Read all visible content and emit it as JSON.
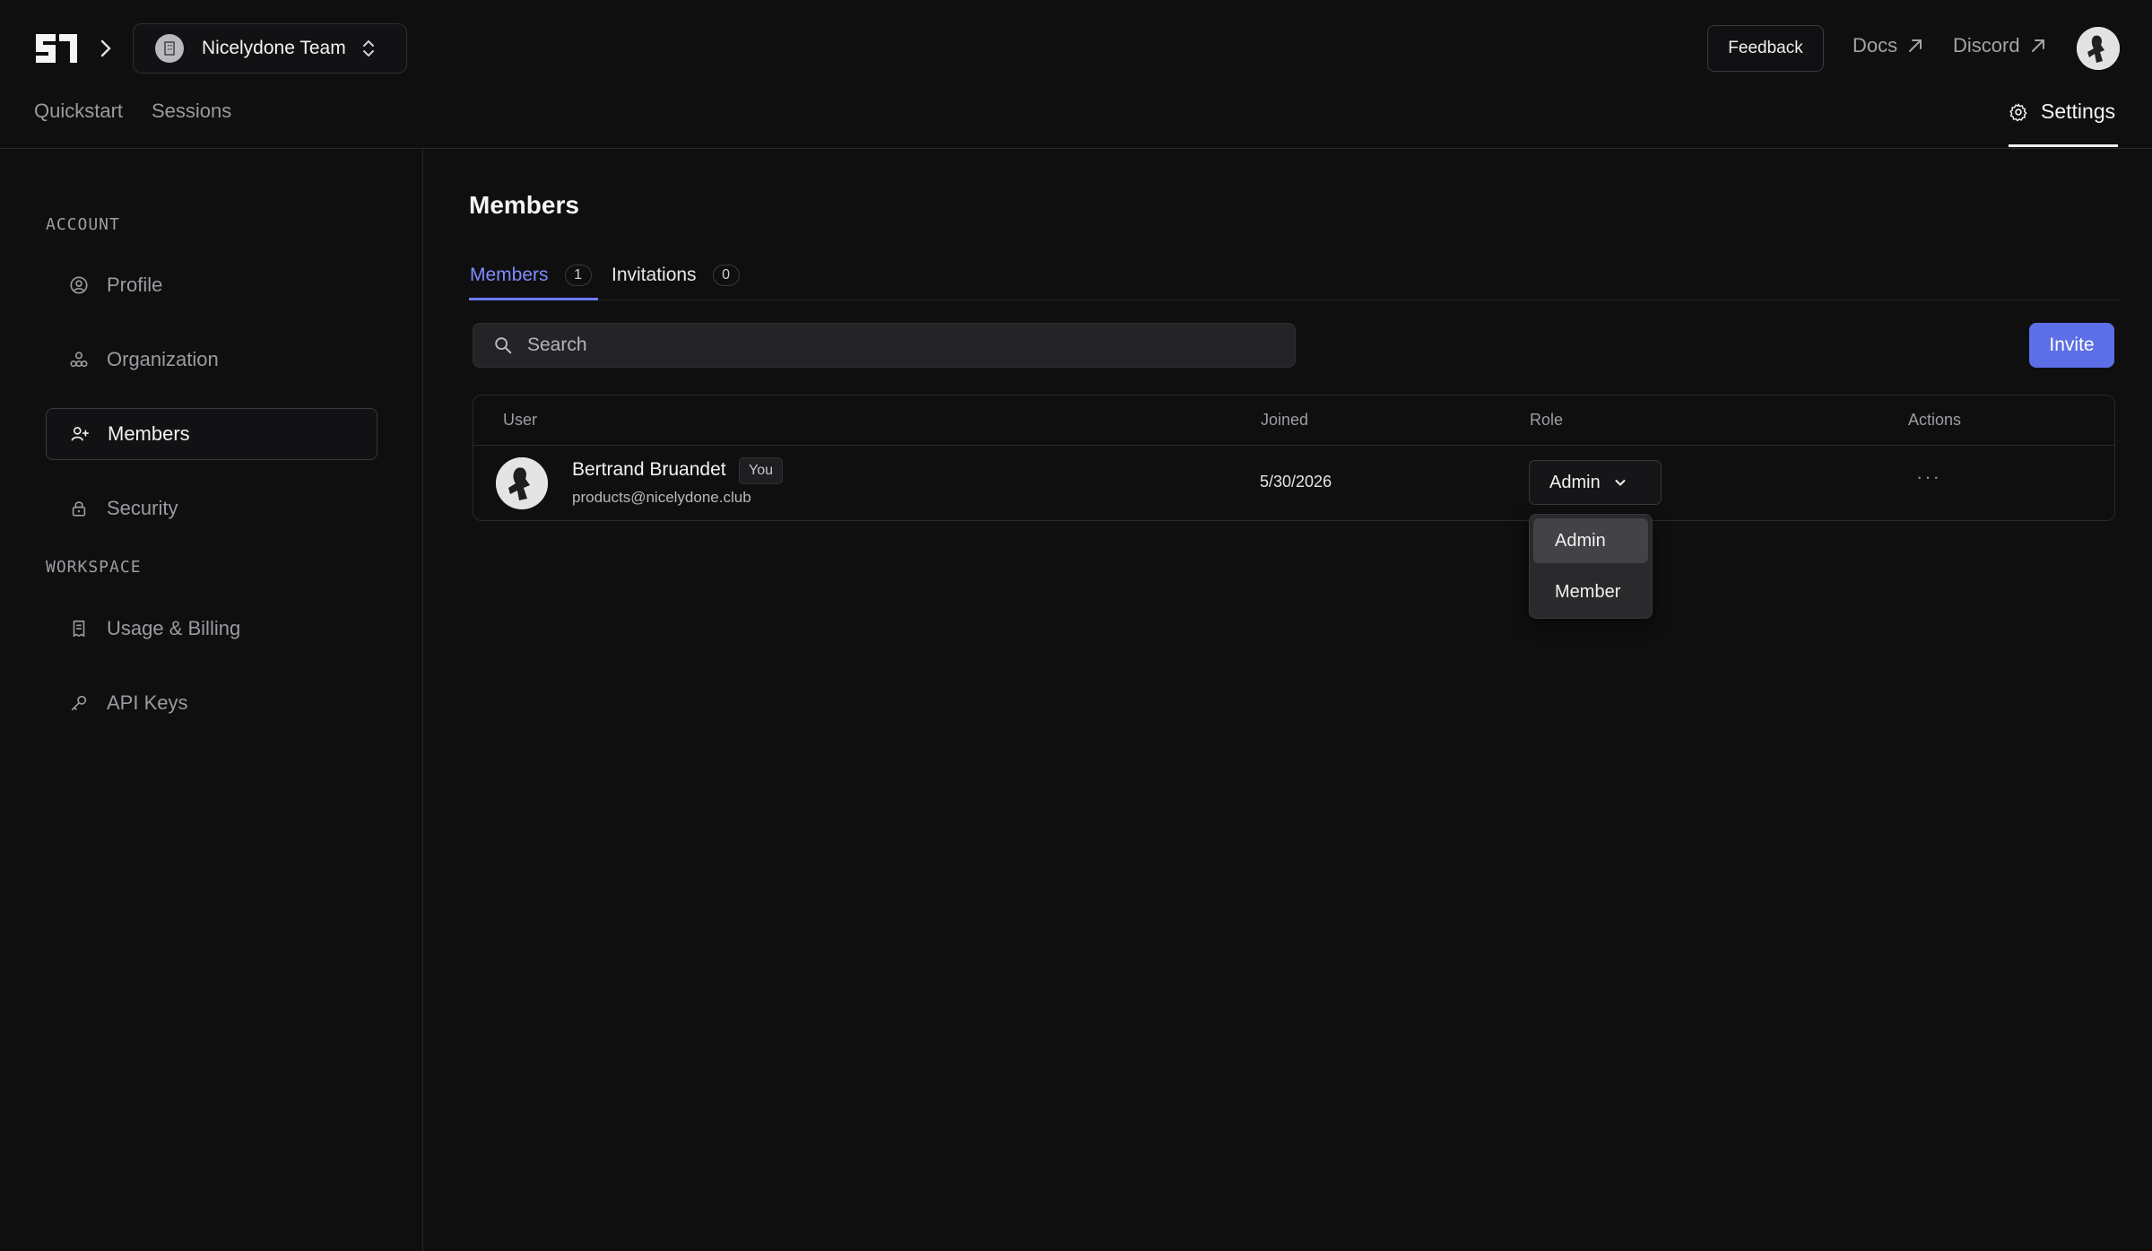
{
  "header": {
    "team_name": "Nicelydone Team",
    "feedback_label": "Feedback",
    "docs_label": "Docs",
    "discord_label": "Discord",
    "nav": {
      "quickstart": "Quickstart",
      "sessions": "Sessions",
      "settings": "Settings"
    }
  },
  "sidebar": {
    "account_label": "ACCOUNT",
    "workspace_label": "WORKSPACE",
    "items": [
      {
        "label": "Profile",
        "icon": "user-circle-icon"
      },
      {
        "label": "Organization",
        "icon": "organization-icon"
      },
      {
        "label": "Members",
        "icon": "user-plus-icon",
        "active": true
      },
      {
        "label": "Security",
        "icon": "lock-icon"
      },
      {
        "label": "Usage & Billing",
        "icon": "receipt-icon"
      },
      {
        "label": "API Keys",
        "icon": "key-icon"
      }
    ]
  },
  "main": {
    "title": "Members",
    "tabs": [
      {
        "label": "Members",
        "count": "1",
        "active": true
      },
      {
        "label": "Invitations",
        "count": "0"
      }
    ],
    "search_placeholder": "Search",
    "invite_label": "Invite",
    "table": {
      "columns": [
        "User",
        "Joined",
        "Role",
        "Actions"
      ],
      "rows": [
        {
          "name": "Bertrand Bruandet",
          "badge": "You",
          "email": "products@nicelydone.club",
          "joined": "5/30/2026",
          "role": "Admin",
          "actions": "···"
        }
      ]
    },
    "role_options": [
      "Admin",
      "Member"
    ],
    "role_selected": "Admin"
  },
  "colors": {
    "background": "#0f0f10",
    "accent": "#6d7cff",
    "invite_button": "#5c6fe6"
  }
}
